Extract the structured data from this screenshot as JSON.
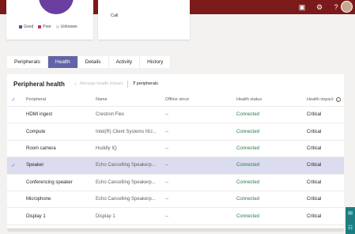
{
  "topbar": {
    "icons": [
      "calendar-icon",
      "gear-icon",
      "help-icon"
    ],
    "help_glyph": "?"
  },
  "summary": {
    "legend": [
      {
        "label": "Good",
        "color": "#6b3fa0"
      },
      {
        "label": "Poor",
        "color": "#c4314b"
      },
      {
        "label": "Unknown",
        "color": "#e1dfdd"
      }
    ],
    "call_label": "Call"
  },
  "tabs": [
    "Peripherals",
    "Health",
    "Details",
    "Activity",
    "History"
  ],
  "active_tab": "Health",
  "panel": {
    "title": "Peripheral health",
    "manage_label": "Manage health impact",
    "count_number": "7",
    "count_text": "peripherals"
  },
  "columns": {
    "peripheral": "Peripheral",
    "name": "Name",
    "offline": "Offline since",
    "status": "Health status",
    "impact": "Health impact"
  },
  "rows": [
    {
      "peripheral": "HDMI ingest",
      "name": "Crestron Flex",
      "offline": "--",
      "status": "Connected",
      "impact": "Critical",
      "selected": false
    },
    {
      "peripheral": "Compute",
      "name": "Intel(R) Client Systems NU...",
      "offline": "--",
      "status": "Connected",
      "impact": "Critical",
      "selected": false
    },
    {
      "peripheral": "Room camera",
      "name": "Huddly IQ",
      "offline": "--",
      "status": "Connected",
      "impact": "Critical",
      "selected": false
    },
    {
      "peripheral": "Speaker",
      "name": "Echo Cancelling Speakerp...",
      "offline": "--",
      "status": "Connected",
      "impact": "Critical",
      "selected": true
    },
    {
      "peripheral": "Conferencing speaker",
      "name": "Echo Cancelling Speakerp...",
      "offline": "--",
      "status": "Connected",
      "impact": "Critical",
      "selected": false
    },
    {
      "peripheral": "Microphone",
      "name": "Echo Cancelling Speakerp...",
      "offline": "--",
      "status": "Connected",
      "impact": "Critical",
      "selected": false
    },
    {
      "peripheral": "Display 1",
      "name": "Display 1",
      "offline": "--",
      "status": "Connected",
      "impact": "Critical",
      "selected": false
    }
  ]
}
